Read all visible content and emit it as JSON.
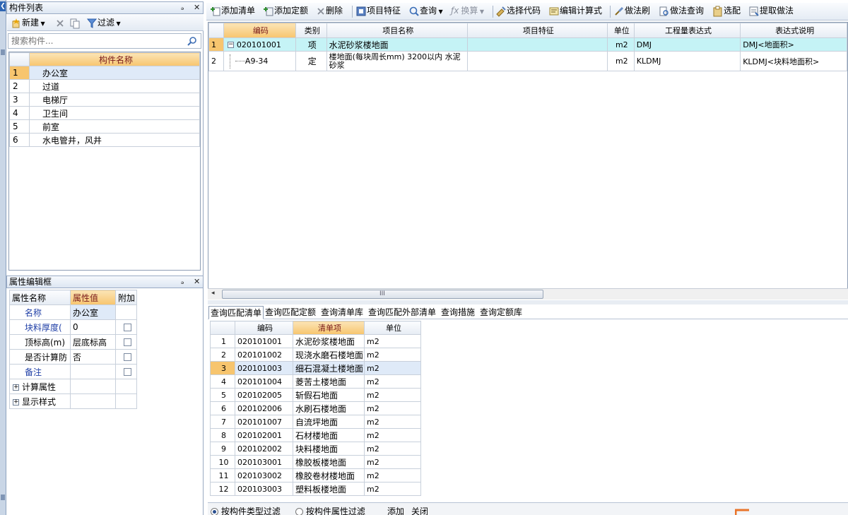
{
  "component_list_panel": {
    "title": "构件列表",
    "pin": "ₔ",
    "close": "✕",
    "toolbar": {
      "new_label": "新建",
      "filter_label": "过滤"
    },
    "search_placeholder": "搜索构件...",
    "column_header": "构件名称",
    "rows": [
      {
        "num": "1",
        "name": "办公室"
      },
      {
        "num": "2",
        "name": "过道"
      },
      {
        "num": "3",
        "name": "电梯厅"
      },
      {
        "num": "4",
        "name": "卫生间"
      },
      {
        "num": "5",
        "name": "前室"
      },
      {
        "num": "6",
        "name": "水电管井，风井"
      }
    ]
  },
  "property_panel": {
    "title": "属性编辑框",
    "headers": {
      "name": "属性名称",
      "value": "属性值",
      "extra": "附加"
    },
    "rows": [
      {
        "name": "名称",
        "value": "办公室"
      },
      {
        "name": "块料厚度(",
        "value": "0"
      },
      {
        "name": "顶标高(m)",
        "value": "层底标高"
      },
      {
        "name": "是否计算防",
        "value": "否"
      },
      {
        "name": "备注",
        "value": ""
      },
      {
        "name": "计算属性",
        "value": ""
      },
      {
        "name": "显示样式",
        "value": ""
      }
    ]
  },
  "main_toolbar": {
    "add_bill": "添加清单",
    "add_quota": "添加定额",
    "delete": "删除",
    "item_feature": "项目特征",
    "query": "查询",
    "convert": "换算",
    "select_code": "选择代码",
    "edit_formula": "编辑计算式",
    "method_brush": "做法刷",
    "method_query": "做法查询",
    "select_match": "选配",
    "extract_method": "提取做法"
  },
  "bill_grid": {
    "headers": [
      "编码",
      "类别",
      "项目名称",
      "项目特征",
      "单位",
      "工程量表达式",
      "表达式说明"
    ],
    "rows": [
      {
        "num": "1",
        "toggle": "−",
        "code": "020101001",
        "type": "项",
        "name": "水泥砂浆楼地面",
        "feature": "",
        "unit": "m2",
        "expr": "DMJ",
        "expr_desc": "DMJ<地面积>"
      },
      {
        "num": "2",
        "code": "A9-34",
        "type": "定",
        "name": "楼地面(每块周长mm) 3200以内 水泥砂浆",
        "feature": "",
        "unit": "m2",
        "expr": "KLDMJ",
        "expr_desc": "KLDMJ<块料地面积>"
      }
    ]
  },
  "scroll_grip": "III",
  "tabs": [
    "查询匹配清单",
    "查询匹配定额",
    "查询清单库",
    "查询匹配外部清单",
    "查询措施",
    "查询定额库"
  ],
  "library_grid": {
    "headers": [
      "编码",
      "清单项",
      "单位"
    ],
    "rows": [
      {
        "num": "1",
        "code": "020101001",
        "name": "水泥砂浆楼地面",
        "unit": "m2"
      },
      {
        "num": "2",
        "code": "020101002",
        "name": "现浇水磨石楼地面",
        "unit": "m2"
      },
      {
        "num": "3",
        "code": "020101003",
        "name": "细石混凝土楼地面",
        "unit": "m2"
      },
      {
        "num": "4",
        "code": "020101004",
        "name": "菱苦土楼地面",
        "unit": "m2"
      },
      {
        "num": "5",
        "code": "020102005",
        "name": "斩假石地面",
        "unit": "m2"
      },
      {
        "num": "6",
        "code": "020102006",
        "name": "水刷石楼地面",
        "unit": "m2"
      },
      {
        "num": "7",
        "code": "020101007",
        "name": "自流坪地面",
        "unit": "m2"
      },
      {
        "num": "8",
        "code": "020102001",
        "name": "石材楼地面",
        "unit": "m2"
      },
      {
        "num": "9",
        "code": "020102002",
        "name": "块料楼地面",
        "unit": "m2"
      },
      {
        "num": "10",
        "code": "020103001",
        "name": "橡胶板楼地面",
        "unit": "m2"
      },
      {
        "num": "11",
        "code": "020103002",
        "name": "橡胶卷材楼地面",
        "unit": "m2"
      },
      {
        "num": "12",
        "code": "020103003",
        "name": "塑料板楼地面",
        "unit": "m2"
      }
    ]
  },
  "bottom_bar": {
    "filter_by_type": "按构件类型过滤",
    "filter_by_attr": "按构件属性过滤",
    "add": "添加",
    "close": "关闭"
  },
  "colors": {
    "header_active": "#f7c56e",
    "selected_row": "#c5f3f6",
    "row_highlight": "#dfeaf8",
    "blue_label": "#1f3fa6"
  }
}
